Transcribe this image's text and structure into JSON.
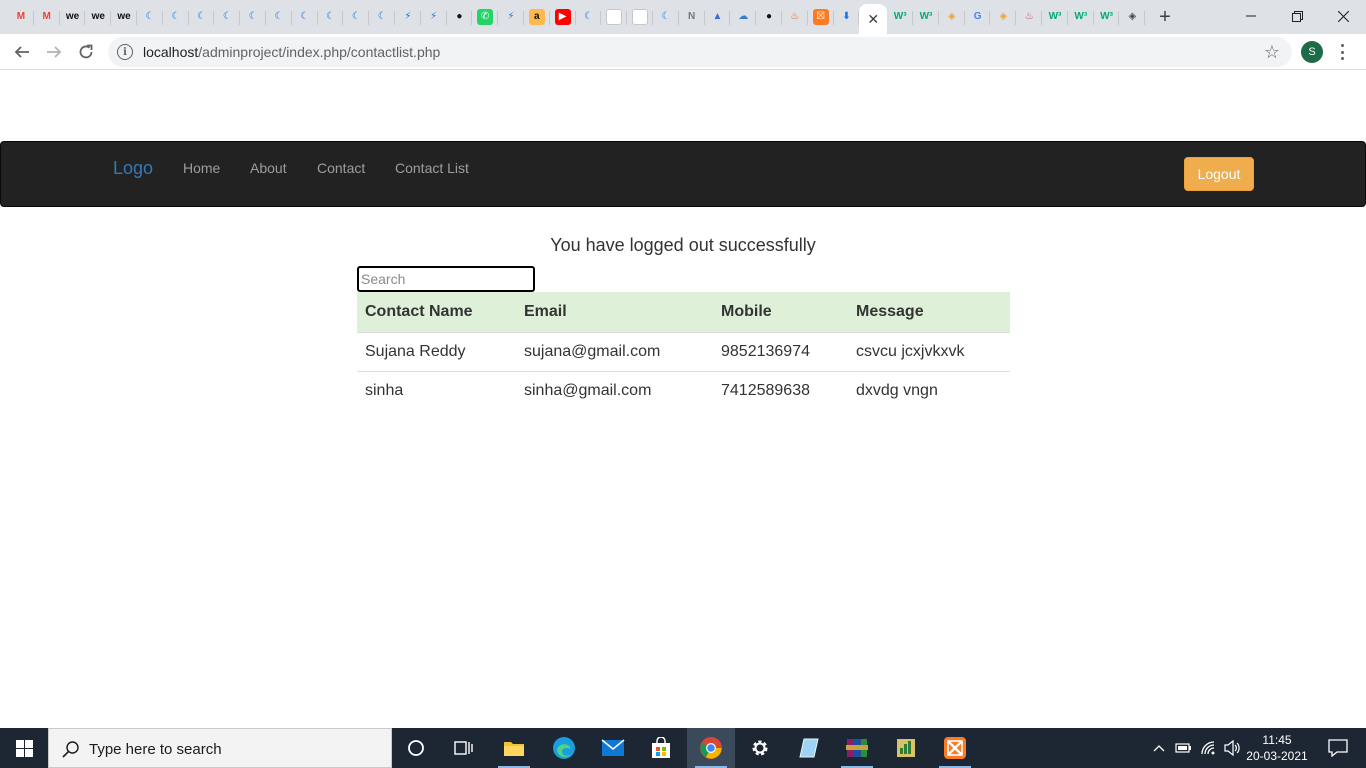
{
  "browser": {
    "tabs": [
      {
        "icon": "gmail-icon",
        "glyph": "M",
        "fg": "#ea4335",
        "bg": "transparent"
      },
      {
        "icon": "gmail-icon",
        "glyph": "M",
        "fg": "#ea4335",
        "bg": "transparent"
      },
      {
        "icon": "we-icon",
        "glyph": "we",
        "fg": "#111111",
        "bg": "transparent"
      },
      {
        "icon": "we-icon",
        "glyph": "we",
        "fg": "#111111",
        "bg": "transparent"
      },
      {
        "icon": "we-icon",
        "glyph": "we",
        "fg": "#111111",
        "bg": "transparent"
      },
      {
        "icon": "crescent-icon",
        "glyph": "☾",
        "fg": "#1a73e8",
        "bg": "transparent"
      },
      {
        "icon": "crescent-icon",
        "glyph": "☾",
        "fg": "#1a73e8",
        "bg": "transparent"
      },
      {
        "icon": "crescent-icon",
        "glyph": "☾",
        "fg": "#1a73e8",
        "bg": "transparent"
      },
      {
        "icon": "crescent-icon",
        "glyph": "☾",
        "fg": "#1a73e8",
        "bg": "transparent"
      },
      {
        "icon": "crescent-icon",
        "glyph": "☾",
        "fg": "#1a73e8",
        "bg": "transparent"
      },
      {
        "icon": "crescent-icon",
        "glyph": "☾",
        "fg": "#1a73e8",
        "bg": "transparent"
      },
      {
        "icon": "crescent-icon",
        "glyph": "☾",
        "fg": "#1a73e8",
        "bg": "transparent"
      },
      {
        "icon": "crescent-icon",
        "glyph": "☾",
        "fg": "#1a73e8",
        "bg": "transparent"
      },
      {
        "icon": "crescent-icon",
        "glyph": "☾",
        "fg": "#1a73e8",
        "bg": "transparent"
      },
      {
        "icon": "crescent-icon",
        "glyph": "☾",
        "fg": "#1a73e8",
        "bg": "transparent"
      },
      {
        "icon": "bolt-icon",
        "glyph": "⚡",
        "fg": "#1a73e8",
        "bg": "transparent"
      },
      {
        "icon": "bolt-icon",
        "glyph": "⚡",
        "fg": "#1a73e8",
        "bg": "transparent"
      },
      {
        "icon": "github-icon",
        "glyph": "●",
        "fg": "#111111",
        "bg": "transparent"
      },
      {
        "icon": "whatsapp-icon",
        "glyph": "✆",
        "fg": "#ffffff",
        "bg": "#25d366"
      },
      {
        "icon": "bolt-icon",
        "glyph": "⚡",
        "fg": "#1a73e8",
        "bg": "transparent"
      },
      {
        "icon": "amazon-icon",
        "glyph": "a",
        "fg": "#111111",
        "bg": "#ffb84d"
      },
      {
        "icon": "youtube-icon",
        "glyph": "▶",
        "fg": "#ffffff",
        "bg": "#ff0000"
      },
      {
        "icon": "crescent-icon",
        "glyph": "☾",
        "fg": "#1a73e8",
        "bg": "transparent"
      },
      {
        "icon": "blank-page-icon",
        "glyph": "",
        "fg": "#ffffff",
        "bg": "#ffffff"
      },
      {
        "icon": "blank-page-icon",
        "glyph": "",
        "fg": "#ffffff",
        "bg": "#ffffff"
      },
      {
        "icon": "crescent-icon",
        "glyph": "☾",
        "fg": "#1a73e8",
        "bg": "transparent"
      },
      {
        "icon": "notion-icon",
        "glyph": "N",
        "fg": "#777777",
        "bg": "transparent"
      },
      {
        "icon": "drive-icon",
        "glyph": "▲",
        "fg": "#3c6fd1",
        "bg": "transparent"
      },
      {
        "icon": "cloud-icon",
        "glyph": "☁",
        "fg": "#3b7bd6",
        "bg": "transparent"
      },
      {
        "icon": "github-icon",
        "glyph": "●",
        "fg": "#111111",
        "bg": "transparent"
      },
      {
        "icon": "fire-icon",
        "glyph": "♨",
        "fg": "#e8590c",
        "bg": "transparent"
      },
      {
        "icon": "xampp-icon",
        "glyph": "☒",
        "fg": "#ffffff",
        "bg": "#fb7a24"
      },
      {
        "icon": "download-icon",
        "glyph": "⬇",
        "fg": "#1a73e8",
        "bg": "transparent"
      }
    ],
    "active_tab_close": "✕",
    "tabs_after": [
      {
        "icon": "w3schools-icon",
        "glyph": "W³",
        "fg": "#04aa6d",
        "bg": "transparent"
      },
      {
        "icon": "w3schools-icon",
        "glyph": "W³",
        "fg": "#04aa6d",
        "bg": "transparent"
      },
      {
        "icon": "compass-icon",
        "glyph": "◈",
        "fg": "#e8a33c",
        "bg": "transparent"
      },
      {
        "icon": "google-icon",
        "glyph": "G",
        "fg": "#4285f4",
        "bg": "transparent"
      },
      {
        "icon": "compass-icon",
        "glyph": "◈",
        "fg": "#e8a33c",
        "bg": "transparent"
      },
      {
        "icon": "flame-icon",
        "glyph": "♨",
        "fg": "#e53935",
        "bg": "transparent"
      },
      {
        "icon": "w3schools-icon",
        "glyph": "W³",
        "fg": "#04aa6d",
        "bg": "transparent"
      },
      {
        "icon": "w3schools-icon",
        "glyph": "W³",
        "fg": "#04aa6d",
        "bg": "transparent"
      },
      {
        "icon": "w3schools-icon",
        "glyph": "W³",
        "fg": "#04aa6d",
        "bg": "transparent"
      },
      {
        "icon": "diamond-icon",
        "glyph": "◈",
        "fg": "#444444",
        "bg": "transparent"
      }
    ],
    "new_tab": "+",
    "url_host": "localhost",
    "url_path": "/adminproject/index.php/contactlist.php",
    "profile_initial": "S"
  },
  "navbar": {
    "brand": "Logo",
    "links": [
      "Home",
      "About",
      "Contact",
      "Contact List"
    ],
    "logout_label": "Logout"
  },
  "main": {
    "message": "You have logged out successfully",
    "search_placeholder": "Search",
    "table": {
      "headers": [
        "Contact Name",
        "Email",
        "Mobile",
        "Message"
      ],
      "rows": [
        [
          "Sujana Reddy",
          "sujana@gmail.com",
          "9852136974",
          "csvcu jcxjvkxvk"
        ],
        [
          "sinha",
          "sinha@gmail.com",
          "7412589638",
          "dxvdg vngn"
        ]
      ]
    }
  },
  "taskbar": {
    "search_placeholder": "Type here to search",
    "time": "11:45",
    "date": "20-03-2021"
  },
  "colors": {
    "navbar_bg": "#222222",
    "brand": "#337ab7",
    "logout_btn": "#f0ad4e",
    "table_header_bg": "#dff0d8",
    "taskbar_bg": "#1c2733"
  }
}
